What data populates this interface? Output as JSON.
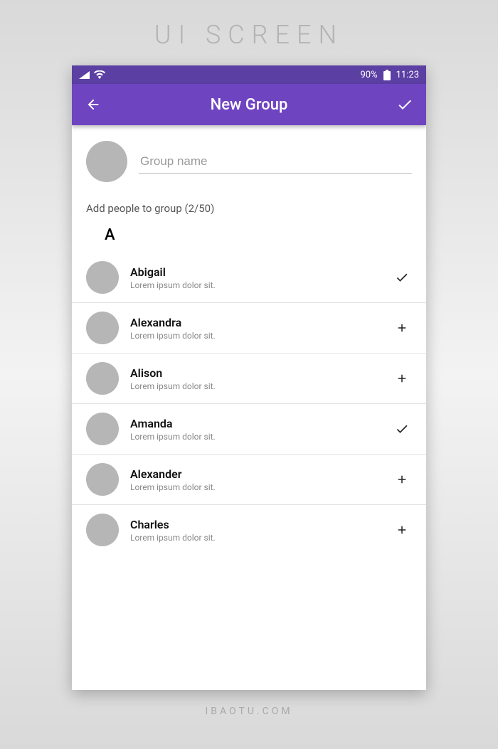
{
  "page_heading": "UI SCREEN",
  "footer": "IBAOTU.COM",
  "statusbar": {
    "battery_pct": "90%",
    "time": "11:23"
  },
  "appbar": {
    "title": "New Group"
  },
  "group_input": {
    "placeholder": "Group name",
    "value": ""
  },
  "subheading": "Add people to group (2/50)",
  "section_letter": "A",
  "contacts": [
    {
      "name": "Abigail",
      "subtitle": "Lorem ipsum dolor sit.",
      "selected": true
    },
    {
      "name": "Alexandra",
      "subtitle": "Lorem ipsum dolor sit.",
      "selected": false
    },
    {
      "name": "Alison",
      "subtitle": "Lorem ipsum dolor sit.",
      "selected": false
    },
    {
      "name": "Amanda",
      "subtitle": "Lorem ipsum dolor sit.",
      "selected": true
    },
    {
      "name": "Alexander",
      "subtitle": "Lorem ipsum dolor sit.",
      "selected": false
    },
    {
      "name": "Charles",
      "subtitle": "Lorem ipsum dolor sit.",
      "selected": false
    }
  ],
  "icons": {
    "back": "←",
    "confirm": "✓",
    "add": "+",
    "selected": "✓"
  }
}
